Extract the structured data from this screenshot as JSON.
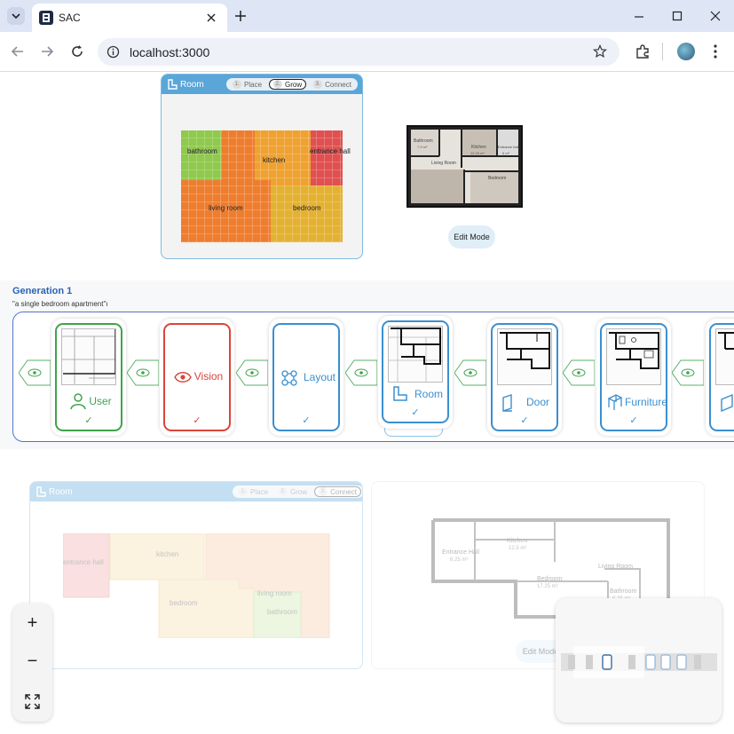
{
  "browser": {
    "tab_title": "SAC",
    "url": "localhost:3000",
    "icons": [
      "tab-list-icon",
      "app-logo-icon",
      "close-icon",
      "new-tab-icon",
      "minimize-icon",
      "maximize-icon",
      "window-close-icon",
      "back-icon",
      "forward-icon",
      "reload-icon",
      "site-info-icon",
      "bookmark-star-icon",
      "extensions-icon",
      "profile-avatar",
      "menu-icon"
    ]
  },
  "room_panel": {
    "title": "Room",
    "steps": [
      {
        "num": "1.",
        "label": "Place"
      },
      {
        "num": "2.",
        "label": "Grow"
      },
      {
        "num": "3.",
        "label": "Connect"
      }
    ],
    "active_step": "Grow",
    "rooms": [
      {
        "label": "bathroom",
        "color": "#8fc94d"
      },
      {
        "label": "kitchen",
        "color": "#efa231"
      },
      {
        "label": "entrance hall",
        "color": "#e05050"
      },
      {
        "label": "living room",
        "color": "#ee7d2e"
      },
      {
        "label": "bedroom",
        "color": "#e4b132"
      }
    ]
  },
  "floorplan_preview": {
    "labels": [
      "Bathroom",
      "7.9 m²",
      "Kitchen",
      "12.25 m²",
      "Entrance hall",
      "6 m²",
      "Living Room",
      "Bedroom"
    ],
    "edit_button": "Edit Mode"
  },
  "generation": {
    "title": "Generation 1",
    "prompt": "\"a single bedroom apartment\"ı",
    "cards": [
      {
        "label": "User",
        "check": "✓",
        "color": "#3fa34d",
        "icon": "user-icon"
      },
      {
        "label": "Vision",
        "check": "✓",
        "color": "#d9453a",
        "icon": "eye-icon"
      },
      {
        "label": "Layout",
        "check": "✓",
        "color": "#3b8fd0",
        "icon": "layout-nodes-icon"
      },
      {
        "label": "Room",
        "check": "✓",
        "color": "#3b8fd0",
        "icon": "room-icon"
      },
      {
        "label": "Door",
        "check": "✓",
        "color": "#3b8fd0",
        "icon": "door-icon"
      },
      {
        "label": "Furniture",
        "check": "✓",
        "color": "#3b8fd0",
        "icon": "furniture-icon"
      }
    ]
  },
  "lower_room_panel": {
    "title": "Room",
    "steps": [
      {
        "num": "1.",
        "label": "Place"
      },
      {
        "num": "2.",
        "label": "Grow"
      },
      {
        "num": "3.",
        "label": "Connect"
      }
    ],
    "active_step": "Connect",
    "rooms": [
      "entrance hall",
      "kitchen",
      "bedroom",
      "living room",
      "bathroom"
    ]
  },
  "lower_floorplan": {
    "labels": [
      {
        "name": "Kitchen",
        "area": "12.5 m²"
      },
      {
        "name": "Entrance Hall",
        "area": "6.25 m²"
      },
      {
        "name": "Living Room",
        "area": ""
      },
      {
        "name": "Bedroom",
        "area": "17.25 m²"
      },
      {
        "name": "Bathroom",
        "area": "6.25 m²"
      }
    ],
    "edit_button": "Edit Mode"
  },
  "controls": {
    "zoom_in": "+",
    "zoom_out": "−"
  }
}
